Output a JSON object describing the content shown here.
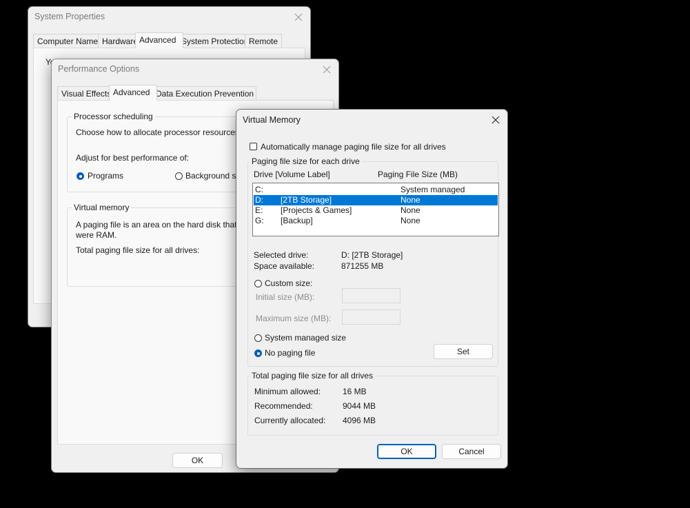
{
  "system_properties": {
    "title": "System Properties",
    "tabs": [
      "Computer Name",
      "Hardware",
      "Advanced",
      "System Protection",
      "Remote"
    ],
    "active_tab": "Advanced",
    "visible_text_start": "Yo"
  },
  "performance_options": {
    "title": "Performance Options",
    "tabs": [
      "Visual Effects",
      "Advanced",
      "Data Execution Prevention"
    ],
    "active_tab": "Advanced",
    "processor_group_title": "Processor scheduling",
    "processor_desc": "Choose how to allocate processor resources.",
    "adjust_label": "Adjust for best performance of:",
    "radio_programs": "Programs",
    "radio_background": "Background se",
    "vm_group_title": "Virtual memory",
    "vm_desc_line1": "A paging file is an area on the hard disk that",
    "vm_desc_line2": "were RAM.",
    "vm_total_label": "Total paging file size for all drives:",
    "ok_label": "OK"
  },
  "virtual_memory": {
    "title": "Virtual Memory",
    "auto_manage_label": "Automatically manage paging file size for all drives",
    "auto_manage_checked": false,
    "each_drive_group_title": "Paging file size for each drive",
    "col_drive": "Drive  [Volume Label]",
    "col_size": "Paging File Size (MB)",
    "drives": [
      {
        "drive": "C:",
        "label": "",
        "size": "System managed"
      },
      {
        "drive": "D:",
        "label": "[2TB Storage]",
        "size": "None"
      },
      {
        "drive": "E:",
        "label": "[Projects & Games]",
        "size": "None"
      },
      {
        "drive": "G:",
        "label": "[Backup]",
        "size": "None"
      }
    ],
    "selected_drive_index": 1,
    "selected_drive_label": "Selected drive:",
    "selected_drive_value": "D:  [2TB Storage]",
    "space_available_label": "Space available:",
    "space_available_value": "871255 MB",
    "custom_size_label": "Custom size:",
    "initial_size_label": "Initial size (MB):",
    "maximum_size_label": "Maximum size (MB):",
    "system_managed_label": "System managed size",
    "no_paging_label": "No paging file",
    "selected_option": "no_paging",
    "set_label": "Set",
    "totals_group_title": "Total paging file size for all drives",
    "min_allowed_label": "Minimum allowed:",
    "min_allowed_value": "16 MB",
    "recommended_label": "Recommended:",
    "recommended_value": "9044 MB",
    "currently_allocated_label": "Currently allocated:",
    "currently_allocated_value": "4096 MB",
    "ok_label": "OK",
    "cancel_label": "Cancel"
  },
  "icons": {
    "close": "close-icon",
    "radio": "radio-button",
    "checkbox": "checkbox"
  },
  "colors": {
    "selection": "#0078d7",
    "accent": "#005fb8",
    "desktop": "#000000"
  }
}
